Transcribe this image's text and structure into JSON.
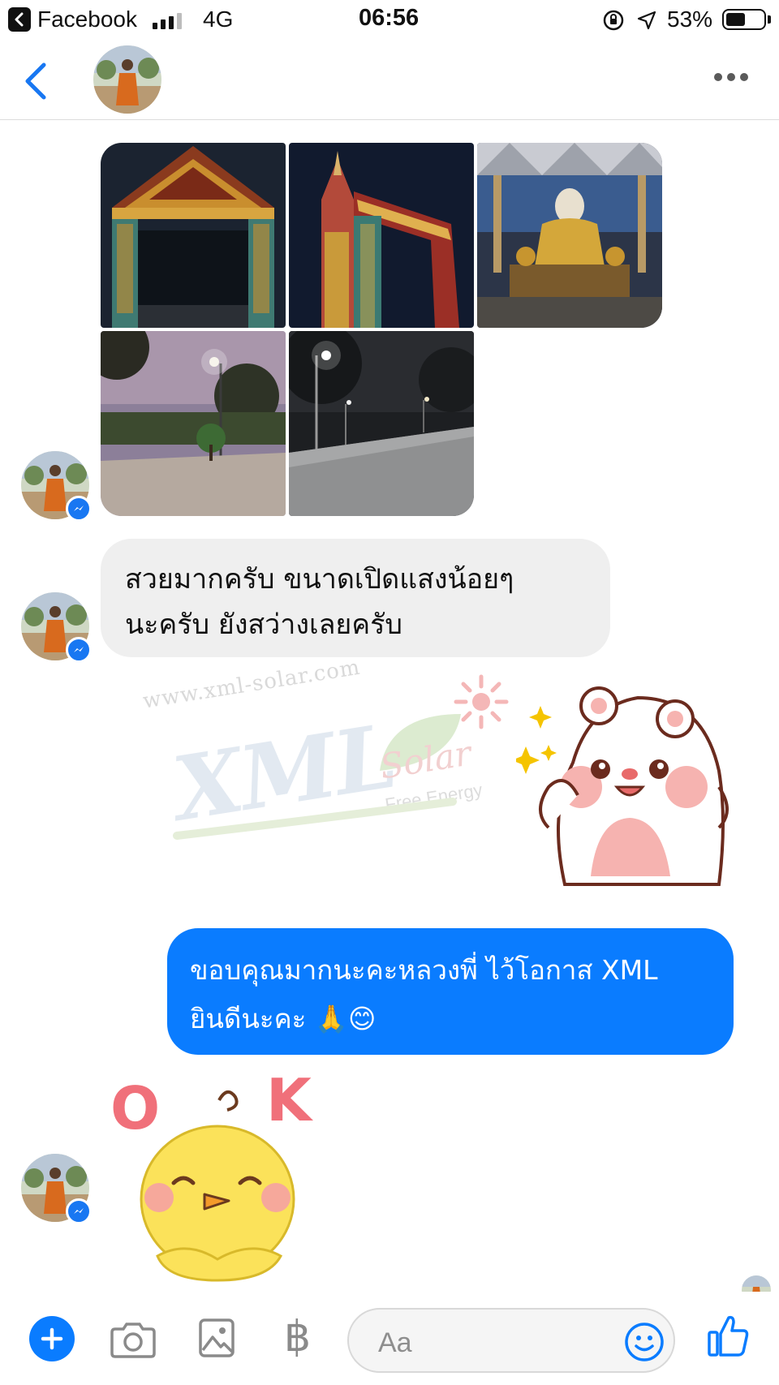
{
  "status_bar": {
    "back_app": "Facebook",
    "network": "4G",
    "time": "06:56",
    "battery_percent": "53%",
    "battery_level": 0.53
  },
  "thread": {
    "photos": [
      {
        "subject": "temple gate at night"
      },
      {
        "subject": "ornate temple arch"
      },
      {
        "subject": "golden Buddha statue"
      },
      {
        "subject": "street light at dusk"
      },
      {
        "subject": "road with solar street lights"
      }
    ],
    "incoming_message": {
      "line1": "สวยมากครับ ขนาดเปิดแสงน้อยๆ",
      "line2": "นะครับ ยังสว่างเลยครับ"
    },
    "watermark": {
      "url": "www.xml-solar.com",
      "logo": "XML",
      "solar": "Solar",
      "tagline": "Free Energy"
    },
    "outgoing_message": {
      "line1": "ขอบคุณมากนะคะหลวงพี่ ไว้โอกาส XML",
      "line2": "ยินดีนะคะ 🙏😊"
    },
    "sticker_text": {
      "o": "O",
      "k": "K"
    }
  },
  "composer": {
    "placeholder": "Aa",
    "baht_symbol": "฿"
  },
  "colors": {
    "messenger_blue": "#0a7cff",
    "incoming_bubble": "#efefef",
    "header_blue": "#1877f2"
  }
}
